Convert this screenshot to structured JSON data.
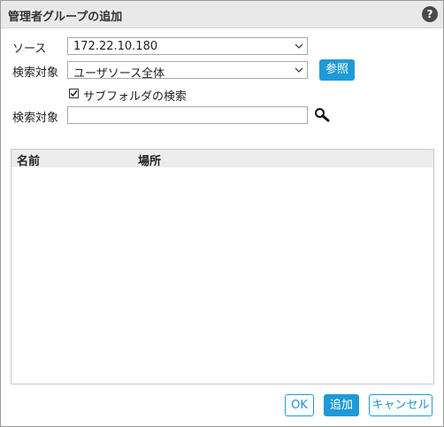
{
  "dialog": {
    "title": "管理者グループの追加",
    "help": "?"
  },
  "form": {
    "source_label": "ソース",
    "source_value": "172.22.10.180",
    "scope_label": "検索対象",
    "scope_value": "ユーザソース全体",
    "browse_button": "参照",
    "subfolder_checked": true,
    "subfolder_label": "サブフォルダの検索",
    "search_label": "検索対象",
    "search_value": ""
  },
  "table": {
    "columns": [
      "名前",
      "場所"
    ],
    "rows": []
  },
  "footer": {
    "ok": "OK",
    "add": "追加",
    "cancel": "キャンセル"
  },
  "colors": {
    "accent": "#1f9ad6",
    "title_bar": "#e9e9e9"
  }
}
